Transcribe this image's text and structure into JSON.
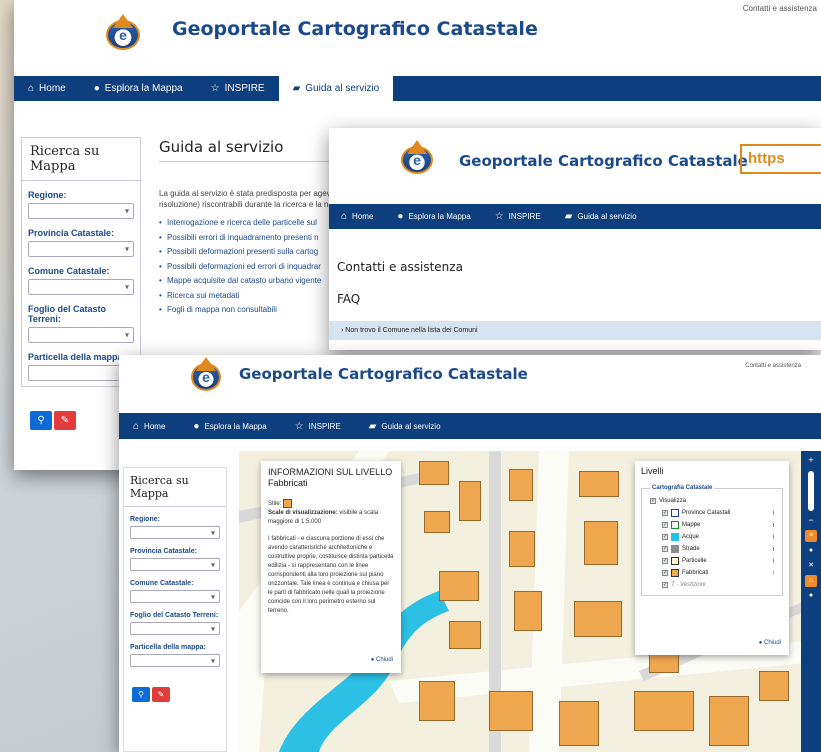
{
  "site_title": "Geoportale Cartografico Catastale",
  "top_link": "Contatti e assistenza",
  "url_fragment": "https",
  "nav": {
    "home": "Home",
    "explore": "Esplora la Mappa",
    "inspire": "INSPIRE",
    "guide": "Guida al servizio"
  },
  "search_panel": {
    "title": "Ricerca su Mappa",
    "regione": "Regione:",
    "provincia": "Provincia Catastale:",
    "comune": "Comune Catastale:",
    "foglio": "Foglio del Catasto Terreni:",
    "particella": "Particella della mappa:"
  },
  "guide": {
    "title": "Guida al servizio",
    "intro_1": "La guida al servizio è stata predisposta per agevol",
    "intro_2": "risoluzione) riscontrabili durante la ricerca e la nav",
    "items": [
      "Interrogazione e ricerca delle particelle sul",
      "Possibili errori di inquadramento presenti n",
      "Possibili deformazioni presenti sulla cartog",
      "Possibili deformazioni ed errori di inquadrar",
      "Mappe acquisite dal catasto urbano vigente",
      "Ricerca sui metadati",
      "Fogli di mappa non consultabili"
    ]
  },
  "contacts": {
    "heading": "Contatti e assistenza",
    "faq": "FAQ",
    "faq_item": "Non trovo il Comune nella lista dei Comuni"
  },
  "layer_info": {
    "title_1": "INFORMAZIONI SUL LIVELLO",
    "title_2": "Fabbricati",
    "stile": "Stile:",
    "scale_label": "Scale di visualizzazione:",
    "scale_value": "visibile a scala maggiore di 1:5.000",
    "description": "I fabbricati - e ciascuna porzione di essi che avendo caratteristiche architettoniche e costruttive proprie, costituisce distinta particella edilizia - si rappresentano con le linee corrispondenti alla loro proiezione sul piano orizzontale. Tale linea è continua e chiusa per le parti di fabbricato nelle quali la proiezione coincide con il loro perimetro esterno sul terreno.",
    "close": "Chiudi"
  },
  "levels": {
    "title": "Livelli",
    "group": "Cartografia Catastale",
    "visualizza": "Visualizza",
    "layers": [
      {
        "name": "Province Catastali",
        "color": "#ffffff",
        "border": "#1b3f9a",
        "checked": true
      },
      {
        "name": "Mappe",
        "color": "#ffffff",
        "border": "#1a8a3a",
        "checked": true
      },
      {
        "name": "Acque",
        "color": "#22c3e6",
        "border": "#22c3e6",
        "checked": true
      },
      {
        "name": "Strade",
        "color": "#8c8c8c",
        "border": "#8c8c8c",
        "checked": true
      },
      {
        "name": "Particelle",
        "color": "#fff6c8",
        "border": "#333333",
        "checked": true
      },
      {
        "name": "Fabbricati",
        "color": "#f0a850",
        "border": "#333333",
        "checked": true
      },
      {
        "name": "T - Vestizioni",
        "color": "",
        "border": "",
        "checked": true
      }
    ],
    "close": "Chiudi"
  },
  "colors": {
    "nav_blue": "#0d3e7d",
    "title_blue": "#1b4a8a",
    "accent_orange": "#e08a1e",
    "search_button": "#0d6ad6",
    "clear_button": "#e23b3b",
    "building_fill": "#f0a850"
  }
}
